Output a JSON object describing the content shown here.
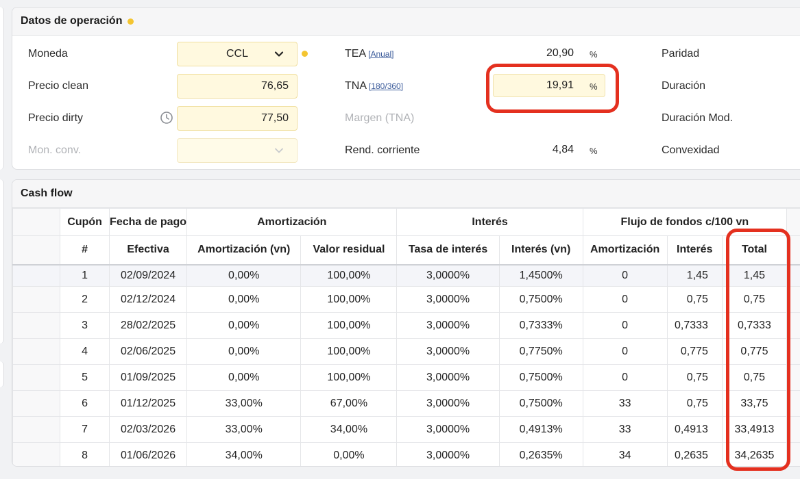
{
  "ops": {
    "title": "Datos de operación",
    "moneda_label": "Moneda",
    "moneda_value": "CCL",
    "precio_clean_label": "Precio clean",
    "precio_clean_value": "76,65",
    "precio_dirty_label": "Precio dirty",
    "precio_dirty_value": "77,50",
    "mon_conv_label": "Mon. conv.",
    "mon_conv_value": "",
    "tea_label": "TEA",
    "tea_link": "[Anual]",
    "tea_value": "20,90",
    "tea_unit": "%",
    "tna_label": "TNA",
    "tna_link": "[180/360]",
    "tna_value": "19,91",
    "tna_unit": "%",
    "margen_label": "Margen (TNA)",
    "rend_label": "Rend. corriente",
    "rend_value": "4,84",
    "rend_unit": "%",
    "paridad_label": "Paridad",
    "duracion_label": "Duración",
    "duracion_mod_label": "Duración Mod.",
    "convexidad_label": "Convexidad"
  },
  "cashflow": {
    "title": "Cash flow",
    "header_groups": {
      "cupon": "Cupón",
      "fecha": "Fecha de pago",
      "amortizacion": "Amortización",
      "interes": "Interés",
      "flujo": "Flujo de fondos c/100 vn"
    },
    "columns": [
      "#",
      "Efectiva",
      "Amortización (vn)",
      "Valor residual",
      "Tasa de interés",
      "Interés (vn)",
      "Amortización",
      "Interés",
      "Total"
    ],
    "rows": [
      [
        "1",
        "02/09/2024",
        "0,00%",
        "100,00%",
        "3,0000%",
        "1,4500%",
        "0",
        "1,45",
        "1,45"
      ],
      [
        "2",
        "02/12/2024",
        "0,00%",
        "100,00%",
        "3,0000%",
        "0,7500%",
        "0",
        "0,75",
        "0,75"
      ],
      [
        "3",
        "28/02/2025",
        "0,00%",
        "100,00%",
        "3,0000%",
        "0,7333%",
        "0",
        "0,7333",
        "0,7333"
      ],
      [
        "4",
        "02/06/2025",
        "0,00%",
        "100,00%",
        "3,0000%",
        "0,7750%",
        "0",
        "0,775",
        "0,775"
      ],
      [
        "5",
        "01/09/2025",
        "0,00%",
        "100,00%",
        "3,0000%",
        "0,7500%",
        "0",
        "0,75",
        "0,75"
      ],
      [
        "6",
        "01/12/2025",
        "33,00%",
        "67,00%",
        "3,0000%",
        "0,7500%",
        "33",
        "0,75",
        "33,75"
      ],
      [
        "7",
        "02/03/2026",
        "33,00%",
        "34,00%",
        "3,0000%",
        "0,4913%",
        "33",
        "0,4913",
        "33,4913"
      ],
      [
        "8",
        "01/06/2026",
        "34,00%",
        "0,00%",
        "3,0000%",
        "0,2635%",
        "34",
        "0,2635",
        "34,2635"
      ]
    ]
  },
  "colors": {
    "highlight_ring": "#e4301f",
    "input_bg": "#fff9df",
    "status_dot": "#f4c531"
  }
}
